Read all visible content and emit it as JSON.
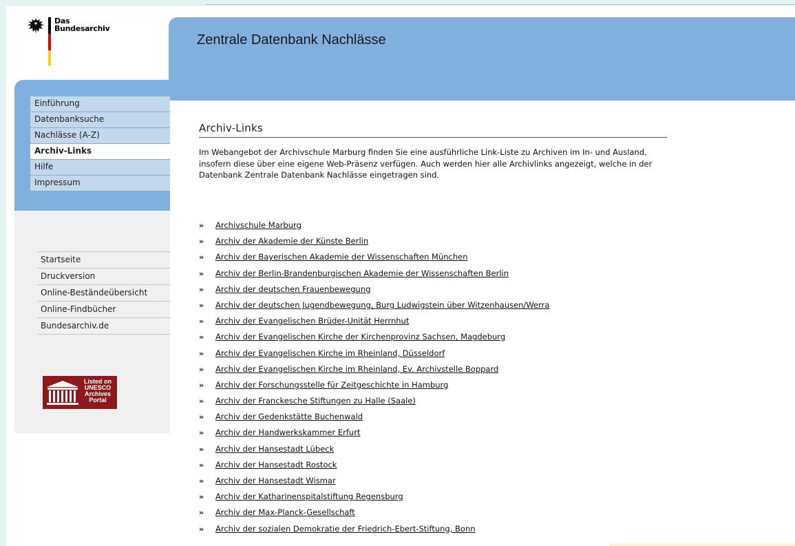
{
  "logo": {
    "line1": "Das",
    "line2": "Bundesarchiv"
  },
  "header": {
    "title": "Zentrale Datenbank Nachlässe"
  },
  "nav": {
    "items": [
      {
        "label": "Einführung",
        "active": false
      },
      {
        "label": "Datenbanksuche",
        "active": false
      },
      {
        "label": "Nachlässe (A-Z)",
        "active": false
      },
      {
        "label": "Archiv-Links",
        "active": true
      },
      {
        "label": "Hilfe",
        "active": false
      },
      {
        "label": "Impressum",
        "active": false
      }
    ]
  },
  "nav2": {
    "items": [
      {
        "label": "Startseite"
      },
      {
        "label": "Druckversion"
      },
      {
        "label": "Online-Beständeübersicht"
      },
      {
        "label": "Online-Findbücher"
      },
      {
        "label": "Bundesarchiv.de"
      }
    ]
  },
  "unesco_badge": {
    "line1": "Listed on",
    "line2": "UNESCO",
    "line3": "Archives",
    "line4": "Portal"
  },
  "main": {
    "section_title": "Archiv-Links",
    "intro": "Im Webangebot der Archivschule Marburg finden Sie eine ausführliche Link-Liste zu Archiven im In- und Ausland, insofern diese über eine eigene Web-Präsenz verfügen. Auch werden hier alle Archivlinks angezeigt, welche in der Datenbank Zentrale Datenbank Nachlässe eingetragen sind.",
    "bullet": "»",
    "links": [
      "Archivschule Marburg",
      "Archiv der Akademie der Künste Berlin",
      "Archiv der Bayerischen Akademie der Wissenschaften München",
      "Archiv der Berlin-Brandenburgischen Akademie der Wissenschaften Berlin",
      "Archiv der deutschen Frauenbewegung",
      "Archiv der deutschen Jugendbewegung, Burg Ludwigstein über Witzenhausen/Werra",
      "Archiv der Evangelischen Brüder-Unität Herrnhut",
      "Archiv der Evangelischen Kirche der Kirchenprovinz Sachsen, Magdeburg",
      "Archiv der Evangelischen Kirche im Rheinland, Düsseldorf",
      "Archiv der Evangelischen Kirche im Rheinland, Ev. Archivstelle Boppard",
      "Archiv der Forschungsstelle für Zeitgeschichte in Hamburg",
      "Archiv der Franckesche Stiftungen zu Halle (Saale)",
      "Archiv der Gedenkstätte Buchenwald",
      "Archiv der Handwerkskammer Erfurt",
      "Archiv der Hansestadt Lübeck",
      "Archiv der Hansestadt Rostock",
      "Archiv der Hansestadt Wismar",
      "Archiv der Katharinenspitalstiftung Regensburg",
      "Archiv der Max-Planck-Gesellschaft",
      "Archiv der sozialen Demokratie der Friedrich-Ebert-Stiftung, Bonn"
    ]
  },
  "colors": {
    "header_blue": "#80b0dd",
    "nav_item_bg": "#c4d8ec",
    "unesco_red": "#8c1a1d",
    "flag_black": "#000000",
    "flag_red": "#dd0000",
    "flag_gold": "#ffce00"
  }
}
